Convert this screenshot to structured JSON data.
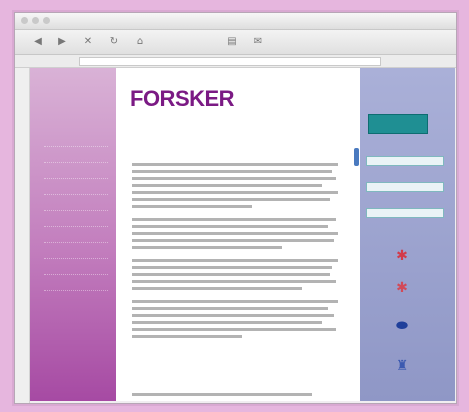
{
  "browser": {
    "title": "",
    "address": ""
  },
  "logo": {
    "main": "FORSKER",
    "suffix": ""
  },
  "tagline": "",
  "left_nav": {
    "items": [
      "",
      "",
      "",
      "",
      "",
      "",
      "",
      "",
      "",
      ""
    ]
  },
  "article": {
    "kicker": "",
    "headline": "",
    "bottom_kicker": ""
  },
  "right_col": {
    "banner": "",
    "boxes": [
      "",
      "",
      ""
    ],
    "icons": [
      "red-badge-icon",
      "red-badge-icon",
      "blue-logo-icon",
      "figure-icon"
    ]
  },
  "colors": {
    "logo": "#7b1a84",
    "left_column": "#c27dbd",
    "right_column": "#9aa1cc",
    "banner": "#1f8f93"
  }
}
